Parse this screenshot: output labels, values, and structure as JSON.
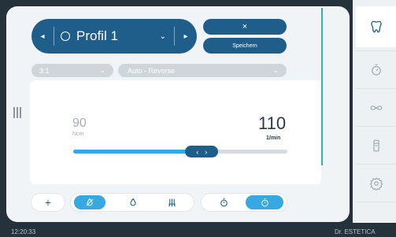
{
  "profile": {
    "name": "Profil 1",
    "prev_icon": "chevron-left-icon",
    "next_icon": "chevron-right-icon",
    "dropdown_icon": "chevron-down-icon"
  },
  "actions": {
    "close_label": "×",
    "save_label": "Speichern"
  },
  "selects": {
    "ratio": "3:1",
    "mode": "Auto - Reverse"
  },
  "torque": {
    "value": "90",
    "unit": "Ncm"
  },
  "speed": {
    "value": "110",
    "unit": "1/min"
  },
  "slider": {
    "level_fraction": 0.6,
    "left_glyph": "‹",
    "right_glyph": "›"
  },
  "controls": {
    "plus_label": "+"
  },
  "status": {
    "time": "12:20:33",
    "user": "Dr. ESTETICA"
  },
  "colors": {
    "accent_dark": "#1f5e8a",
    "accent_light": "#37a8e0",
    "teal_line": "#2fb3b0"
  }
}
